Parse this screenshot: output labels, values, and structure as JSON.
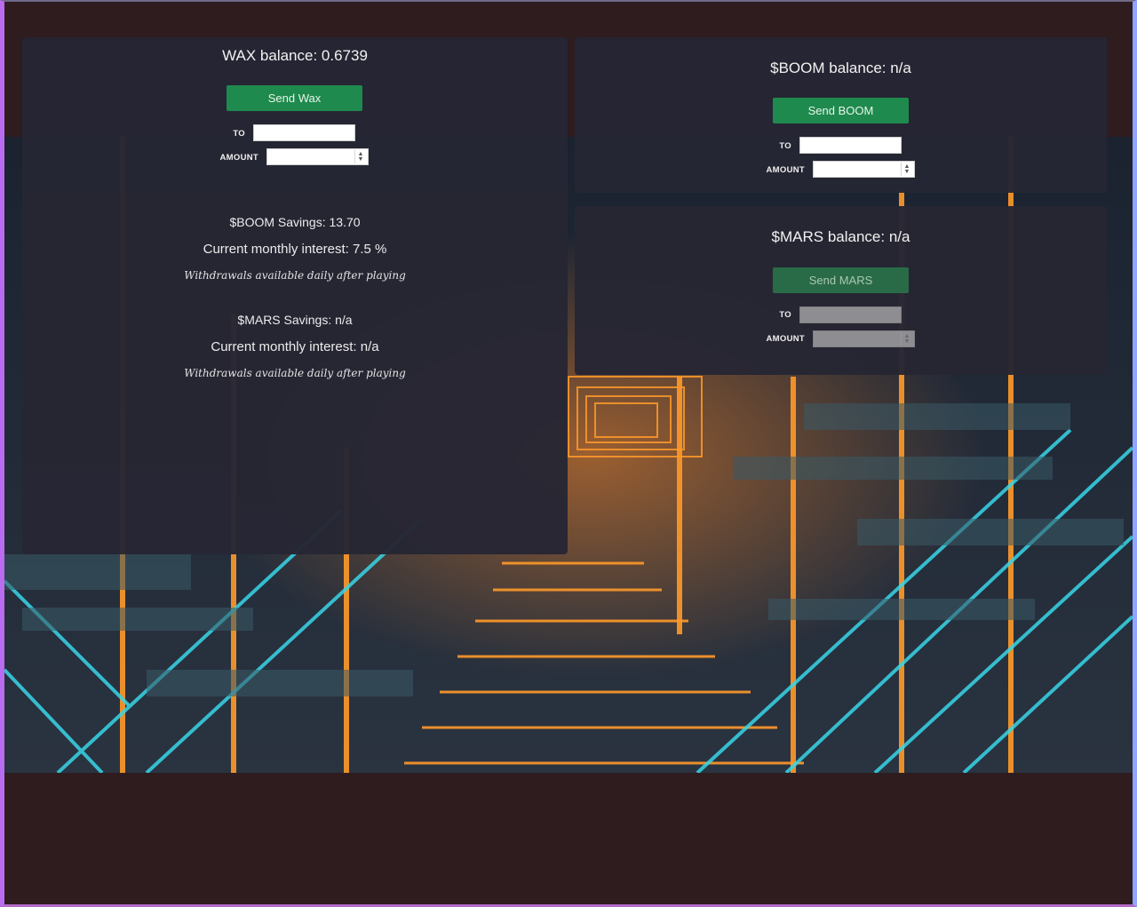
{
  "wax": {
    "balance_text": "WAX balance: 0.6739",
    "send_button": "Send Wax",
    "to_label": "TO",
    "amount_label": "AMOUNT",
    "to_value": "",
    "amount_value": ""
  },
  "boom_savings": {
    "savings_text": "$BOOM Savings: 13.70",
    "interest_text": "Current monthly interest: 7.5 %",
    "note_text": "Withdrawals available daily after playing"
  },
  "mars_savings": {
    "savings_text": "$MARS Savings: n/a",
    "interest_text": "Current monthly interest: n/a",
    "note_text": "Withdrawals available daily after playing"
  },
  "boom": {
    "balance_text": "$BOOM balance: n/a",
    "send_button": "Send BOOM",
    "to_label": "TO",
    "amount_label": "AMOUNT",
    "to_value": "",
    "amount_value": ""
  },
  "mars": {
    "balance_text": "$MARS balance: n/a",
    "send_button": "Send MARS",
    "to_label": "TO",
    "amount_label": "AMOUNT",
    "to_value": "",
    "amount_value": "",
    "disabled": true
  },
  "icons": {
    "spinner": "number-spinner-icon"
  },
  "colors": {
    "button_green": "#1f8a4d",
    "panel_bg": "#262634",
    "page_bg": "#2e1c1f",
    "neon_orange": "#ff9a2a",
    "neon_cyan": "#38d6e8"
  }
}
